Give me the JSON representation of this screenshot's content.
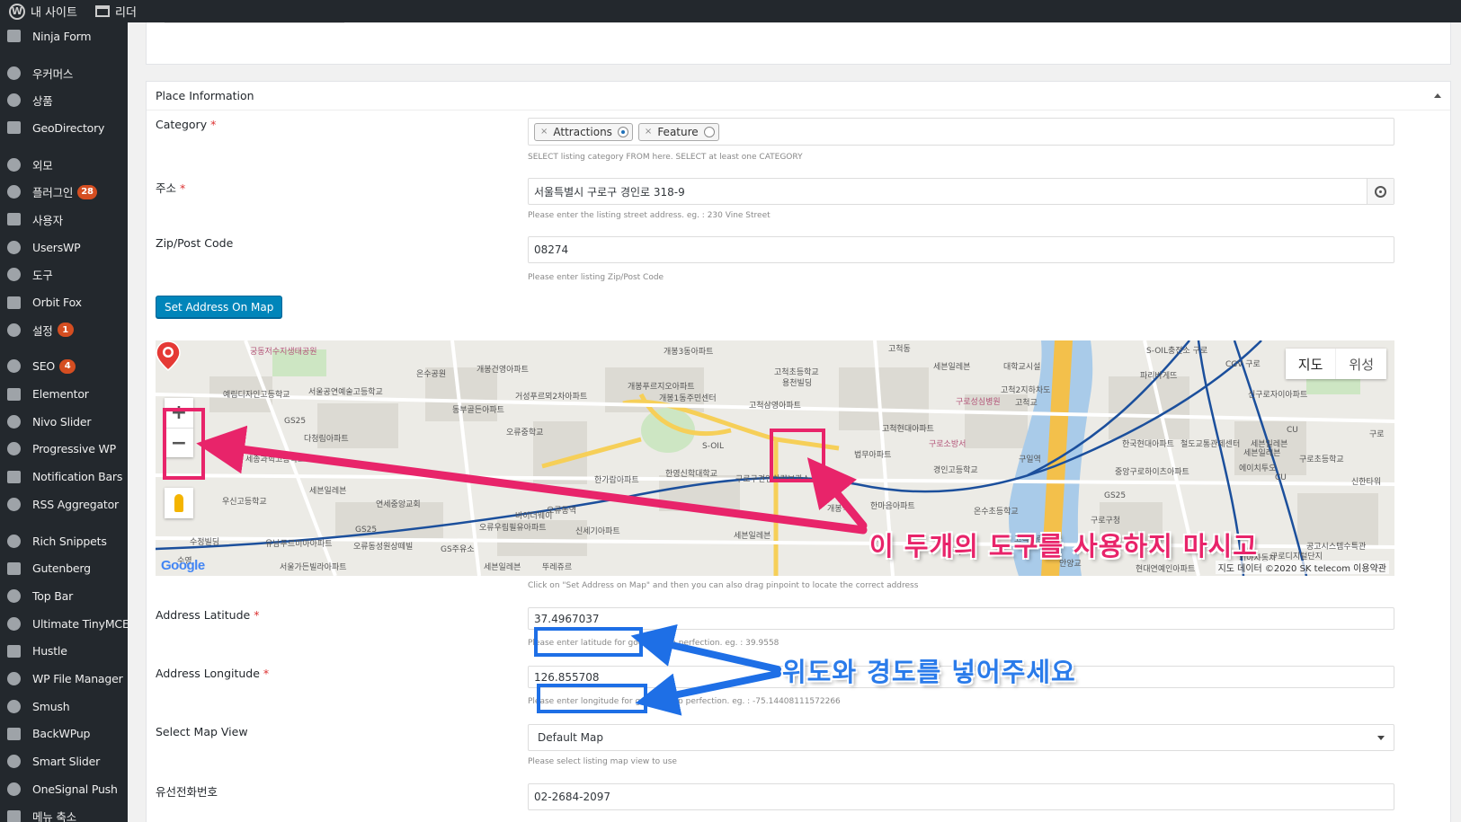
{
  "adminbar": {
    "site_label": "내 사이트",
    "reader_label": "리더"
  },
  "sidebar": {
    "items": [
      {
        "label": "Ninja Form",
        "icon": "form-icon"
      },
      {
        "label": "우커머스",
        "icon": "woo-icon"
      },
      {
        "label": "상품",
        "icon": "products-icon"
      },
      {
        "label": "GeoDirectory",
        "icon": "globe-icon"
      },
      {
        "label": "외모",
        "icon": "paintbrush-icon"
      },
      {
        "label": "플러그인",
        "icon": "plugin-icon",
        "badge": "28"
      },
      {
        "label": "사용자",
        "icon": "user-icon"
      },
      {
        "label": "UsersWP",
        "icon": "gear-cluster-icon"
      },
      {
        "label": "도구",
        "icon": "wrench-icon"
      },
      {
        "label": "Orbit Fox",
        "icon": "fox-icon"
      },
      {
        "label": "설정",
        "icon": "settings-icon",
        "badge": "1"
      },
      {
        "label": "SEO",
        "icon": "seo-icon",
        "badge": "4"
      },
      {
        "label": "Elementor",
        "icon": "elementor-icon"
      },
      {
        "label": "Nivo Slider",
        "icon": "slider-icon"
      },
      {
        "label": "Progressive WP",
        "icon": "pwa-icon"
      },
      {
        "label": "Notification Bars",
        "icon": "info-icon"
      },
      {
        "label": "RSS Aggregator",
        "icon": "rss-icon"
      },
      {
        "label": "Rich Snippets",
        "icon": "star-icon"
      },
      {
        "label": "Gutenberg",
        "icon": "pen-icon"
      },
      {
        "label": "Top Bar",
        "icon": "gear-icon"
      },
      {
        "label": "Ultimate TinyMCE",
        "icon": "gear-icon"
      },
      {
        "label": "Hustle",
        "icon": "hustle-icon"
      },
      {
        "label": "WP File Manager",
        "icon": "folder-icon"
      },
      {
        "label": "Smush",
        "icon": "smush-icon"
      },
      {
        "label": "BackWPup",
        "icon": "backup-icon"
      },
      {
        "label": "Smart Slider",
        "icon": "flag-icon"
      },
      {
        "label": "OneSignal Push",
        "icon": "bell-icon"
      },
      {
        "label": "메뉴 축소",
        "icon": "collapse-icon"
      }
    ]
  },
  "panel": {
    "title": "Place Information"
  },
  "fields": {
    "category": {
      "label": "Category",
      "required": "*",
      "chips": [
        {
          "label": "Attractions",
          "remove": "×"
        },
        {
          "label": "Feature",
          "remove": "×"
        }
      ],
      "help": "SELECT listing category FROM here. SELECT at least one CATEGORY"
    },
    "address": {
      "label": "주소",
      "required": "*",
      "value": "서울특별시 구로구 경인로 318-9",
      "help": "Please enter the listing street address. eg. : 230 Vine Street"
    },
    "zip": {
      "label": "Zip/Post Code",
      "value": "08274",
      "help": "Please enter listing Zip/Post Code"
    },
    "set_address_button": "Set Address On Map",
    "map": {
      "type_map": "지도",
      "type_satellite": "위성",
      "zoom_in": "+",
      "zoom_out": "−",
      "google": "Google",
      "copyright": "지도 데이터 ©2020 SK telecom   이용약관",
      "help": "Click on \"Set Address on Map\" and then you can also drag pinpoint to locate the correct address",
      "labels": [
        {
          "text": "궁동저수지생태공원",
          "pink": true
        },
        {
          "text": "개봉3동아파트"
        },
        {
          "text": "고척동"
        },
        {
          "text": "세븐일레븐"
        },
        {
          "text": "대학교시설"
        },
        {
          "text": "S-OIL충전소 구로"
        },
        {
          "text": "CGV 구로"
        },
        {
          "text": "온수공원"
        },
        {
          "text": "개봉건영아파트"
        },
        {
          "text": "고척초등학교"
        },
        {
          "text": "용천빌딩"
        },
        {
          "text": "고척2지하차도"
        },
        {
          "text": "파리바게뜨"
        },
        {
          "text": "신구로자이아파트"
        },
        {
          "text": "예림디자인고등학교"
        },
        {
          "text": "서울공연예술고등학교"
        },
        {
          "text": "거성푸르뫼2차아파트"
        },
        {
          "text": "개봉푸르지오아파트"
        },
        {
          "text": "개봉1동주민센터"
        },
        {
          "text": "구로성심병원",
          "pink": true
        },
        {
          "text": "고척교"
        },
        {
          "text": "동부골든아파트"
        },
        {
          "text": "고척삼영아파트"
        },
        {
          "text": "GS25"
        },
        {
          "text": "다청림아파트"
        },
        {
          "text": "오류중학교"
        },
        {
          "text": "고척현대아파트"
        },
        {
          "text": "구로소방서",
          "pink": true
        },
        {
          "text": "한국현대아파트"
        },
        {
          "text": "철도교통관제센터"
        },
        {
          "text": "세븐일레븐"
        },
        {
          "text": "CU"
        },
        {
          "text": "구로"
        },
        {
          "text": "세종과학고등학교"
        },
        {
          "text": "S-OIL"
        },
        {
          "text": "법무아파트"
        },
        {
          "text": "구일역"
        },
        {
          "text": "경인고등학교"
        },
        {
          "text": "중앙구로하이츠아파트"
        },
        {
          "text": "구로초등학교"
        },
        {
          "text": "세븐일레븐"
        },
        {
          "text": "한가람아파트"
        },
        {
          "text": "한영신학대학교"
        },
        {
          "text": "구로구견인차량보관소"
        },
        {
          "text": "에이치투오"
        },
        {
          "text": "신한타워"
        },
        {
          "text": "우신고등학교"
        },
        {
          "text": "세븐일레븐"
        },
        {
          "text": "연세중앙교회"
        },
        {
          "text": "오류동역"
        },
        {
          "text": "개봉역"
        },
        {
          "text": "한마음아파트"
        },
        {
          "text": "GS25"
        },
        {
          "text": "구로구청"
        },
        {
          "text": "온수초등학교"
        },
        {
          "text": "CU"
        },
        {
          "text": "바이더웨이"
        },
        {
          "text": "오류우림필유아파트"
        },
        {
          "text": "신세기아파트"
        },
        {
          "text": "세븐일레븐"
        },
        {
          "text": "고척근린공원"
        },
        {
          "text": "광복교"
        },
        {
          "text": "기아자동차"
        },
        {
          "text": "구로디지털단지"
        },
        {
          "text": "수정빌딩"
        },
        {
          "text": "유남푸르미아아파트"
        },
        {
          "text": "GS25"
        },
        {
          "text": "오류동성원상떼빌"
        },
        {
          "text": "GS주유소"
        },
        {
          "text": "공고시스템수특관"
        },
        {
          "text": "서울가든빌라아파트"
        },
        {
          "text": "세븐일레븐"
        },
        {
          "text": "뚜레쥬르"
        },
        {
          "text": "안양교"
        },
        {
          "text": "현대연예인아파트"
        },
        {
          "text": "수영"
        }
      ]
    },
    "latitude": {
      "label": "Address Latitude",
      "required": "*",
      "value": "37.4967037",
      "help": "Please enter latitude for google map perfection. eg. : 39.9558"
    },
    "longitude": {
      "label": "Address Longitude",
      "required": "*",
      "value": "126.855708",
      "help": "Please enter longitude for google map perfection. eg. : -75.14408111572266"
    },
    "map_view": {
      "label": "Select Map View",
      "value": "Default Map",
      "help": "Please select listing map view to use"
    },
    "phone": {
      "label": "유선전화번호",
      "value": "02-2684-2097"
    }
  },
  "annotations": {
    "map_tools": "이 두개의 도구를 사용하지 마시고",
    "lat_lng": "위도와 경도를 넣어주세요"
  },
  "colors": {
    "annotation_pink": "#e8246a",
    "annotation_blue": "#1e6fe6",
    "primary_button": "#0085ba",
    "sidebar_bg": "#23282d"
  }
}
